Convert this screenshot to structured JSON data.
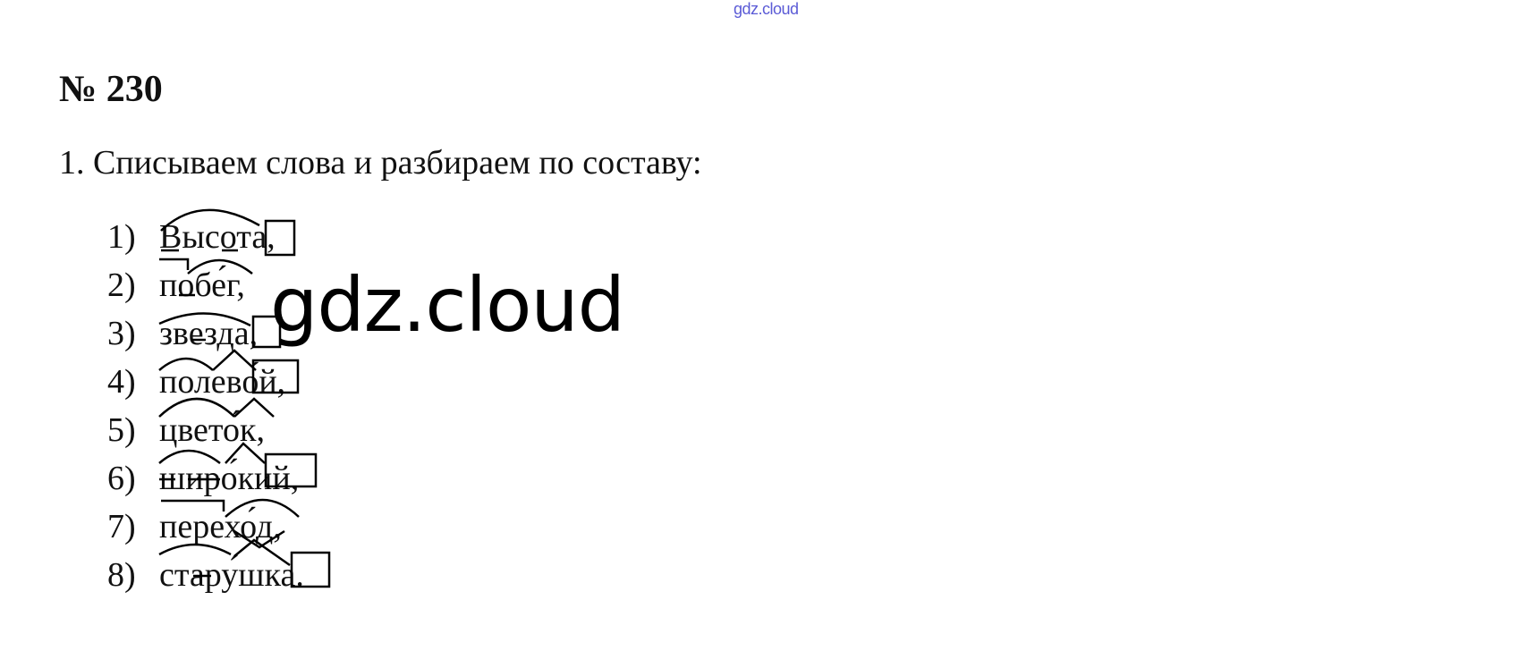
{
  "watermark_top": "gdz.cloud",
  "watermark_center": "gdz.cloud",
  "task": {
    "number": "№ 230",
    "instruction": "1. Списываем слова и разбираем по составу:",
    "items": [
      {
        "num": "1)",
        "word": "Высота,"
      },
      {
        "num": "2)",
        "word": "побе́г,"
      },
      {
        "num": "3)",
        "word": "звезда,"
      },
      {
        "num": "4)",
        "word": "полево́й,"
      },
      {
        "num": "5)",
        "word": "цвето́к,"
      },
      {
        "num": "6)",
        "word": "широ́кий,"
      },
      {
        "num": "7)",
        "word": "перехо́д,"
      },
      {
        "num": "8)",
        "word": "стару́шка."
      }
    ]
  }
}
